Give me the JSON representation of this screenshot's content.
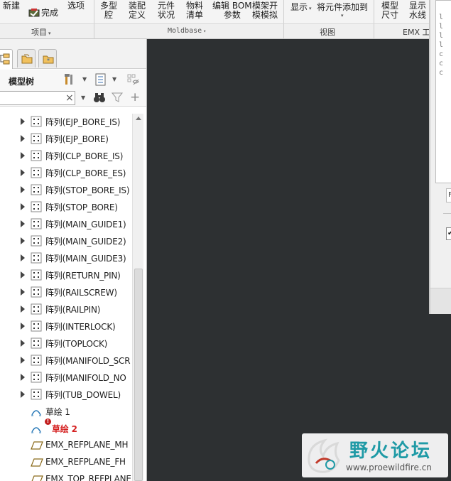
{
  "ribbon": {
    "new_label": "新建",
    "finish_label": "完成",
    "options_label": "选项",
    "multi_cavity_l1": "多型",
    "multi_cavity_l2": "腔",
    "assembly_def_l1": "装配",
    "assembly_def_l2": "定义",
    "component_status_l1": "元件",
    "component_status_l2": "状况",
    "bom_l1": "物料",
    "bom_l2": "清单",
    "edit_bom_l1": "编辑 BOM",
    "edit_bom_l2": "参数",
    "mold_sim_l1": "模架开",
    "mold_sim_l2": "模模拟",
    "display_label": "显示",
    "add_component_label": "将元件添加到",
    "model_size_l1": "模型",
    "model_size_l2": "尺寸",
    "waterline_l1": "显示",
    "waterline_l2": "水线",
    "groups": {
      "project": "项目",
      "moldbase": "Moldbase",
      "view": "视图",
      "emx_tools": "EMX 工"
    }
  },
  "panel": {
    "tree_title": "模型树",
    "search_value": "",
    "clear_glyph": "×"
  },
  "tree": {
    "items": [
      {
        "label": "阵列(EJP_BORE_IS)"
      },
      {
        "label": "阵列(EJP_BORE)"
      },
      {
        "label": "阵列(CLP_BORE_IS)"
      },
      {
        "label": "阵列(CLP_BORE_ES)"
      },
      {
        "label": "阵列(STOP_BORE_IS)"
      },
      {
        "label": "阵列(STOP_BORE)"
      },
      {
        "label": "阵列(MAIN_GUIDE1)"
      },
      {
        "label": "阵列(MAIN_GUIDE2)"
      },
      {
        "label": "阵列(MAIN_GUIDE3)"
      },
      {
        "label": "阵列(RETURN_PIN)"
      },
      {
        "label": "阵列(RAILSCREW)"
      },
      {
        "label": "阵列(RAILPIN)"
      },
      {
        "label": "阵列(INTERLOCK)"
      },
      {
        "label": "阵列(TOPLOCK)"
      },
      {
        "label": "阵列(MANIFOLD_SCR"
      },
      {
        "label": "阵列(MANIFOLD_NO"
      },
      {
        "label": "阵列(TUB_DOWEL)"
      }
    ],
    "sketch1": "草绘 1",
    "sketch2": "草绘 2",
    "error_glyph": "!",
    "plane1": "EMX_REFPLANE_MH",
    "plane2": "EMX_REFPLANE_FH",
    "plane3": "EMX_TOP_REFPLANE"
  },
  "dialog": {
    "field_value": "F",
    "check_glyph": "✔"
  },
  "watermark": {
    "title": "野火论坛",
    "url": "www.proewildfire.cn"
  },
  "colors": {
    "graphics_bg": "#2d3032",
    "error_red": "#d52121",
    "watermark_teal": "#1f9aa6"
  }
}
